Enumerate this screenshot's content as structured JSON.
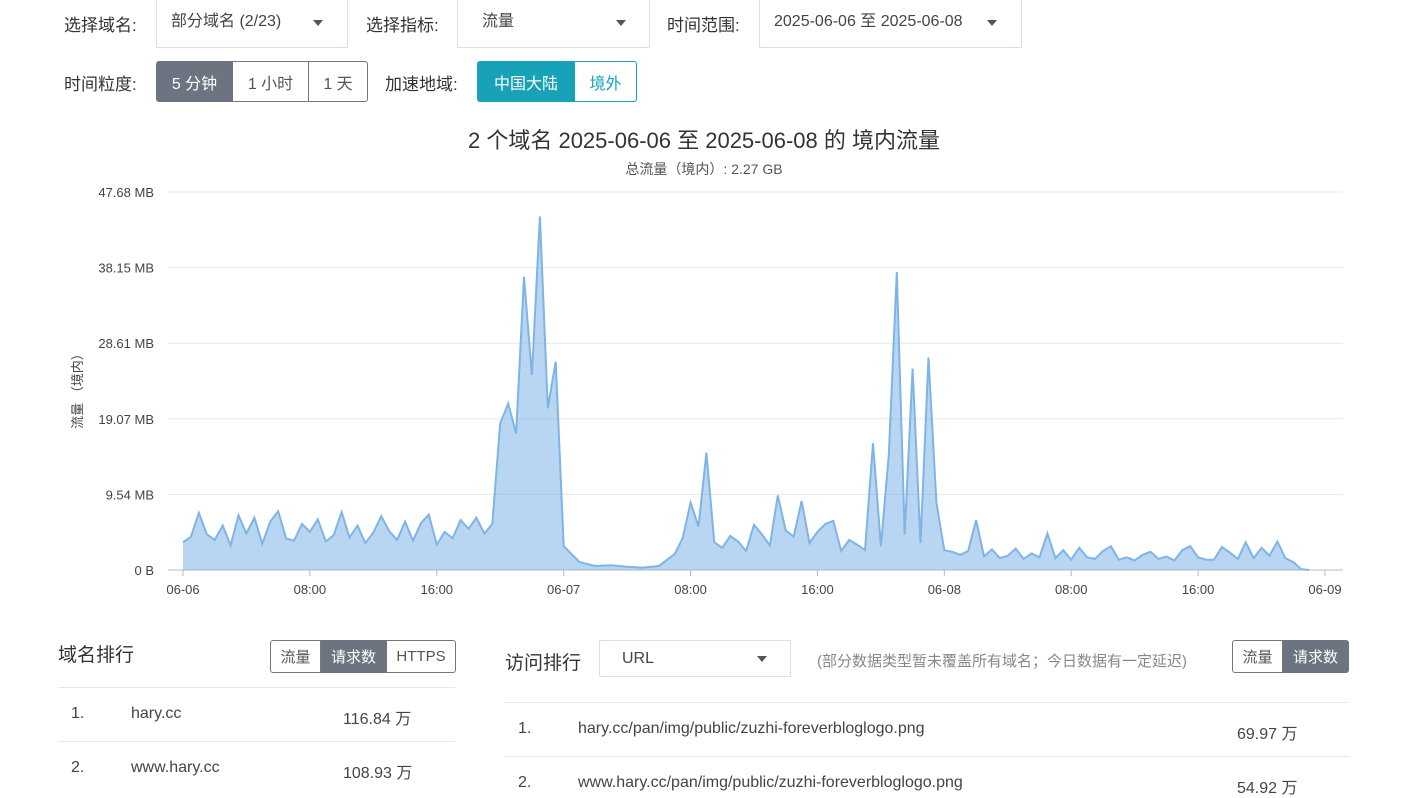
{
  "filters": {
    "domain_label": "选择域名:",
    "domain_value": "部分域名 (2/23)",
    "metric_label": "选择指标:",
    "metric_value": "流量",
    "range_label": "时间范围:",
    "range_value": "2025-06-06 至 2025-06-08",
    "granularity_label": "时间粒度:",
    "granularity_options": [
      "5 分钟",
      "1 小时",
      "1 天"
    ],
    "granularity_selected": "5 分钟",
    "region_label": "加速地域:",
    "region_options": [
      "中国大陆",
      "境外"
    ],
    "region_selected": "中国大陆"
  },
  "chart": {
    "title": "2 个域名 2025-06-06 至 2025-06-08 的 境内流量",
    "subtitle": "总流量（境内）: 2.27 GB"
  },
  "chart_data": {
    "type": "area",
    "title": "2 个域名 2025-06-06 至 2025-06-08 的 境内流量",
    "subtitle": "总流量（境内）: 2.27 GB",
    "ylabel": "流量 （境内）",
    "y_ticks": [
      "0 B",
      "9.54 MB",
      "19.07 MB",
      "28.61 MB",
      "38.15 MB",
      "47.68 MB"
    ],
    "ylim": [
      0,
      47.68
    ],
    "y_unit": "MB",
    "x_ticks": [
      "06-06",
      "08:00",
      "16:00",
      "06-07",
      "08:00",
      "16:00",
      "06-08",
      "08:00",
      "16:00",
      "06-09"
    ],
    "xlim_hours": [
      0,
      72
    ],
    "grid": true,
    "color": "#7eb4e6",
    "series": [
      {
        "x_hours": [
          0,
          0.5,
          1,
          1.5,
          2,
          2.5,
          3,
          3.5,
          4,
          4.5,
          5,
          5.5,
          6,
          6.5,
          7,
          7.5,
          8,
          8.5,
          9,
          9.5,
          10,
          10.5,
          11,
          11.5,
          12,
          12.5,
          13,
          13.5,
          14,
          14.5,
          15,
          15.5,
          16,
          16.5,
          17,
          17.5,
          18,
          18.5,
          19,
          19.5,
          20,
          20.5,
          21,
          21.5,
          22,
          22.5,
          23,
          23.5,
          24,
          25,
          26,
          27,
          28,
          29,
          30,
          31,
          31.5,
          32,
          32.5,
          33,
          33.5,
          34,
          34.5,
          35,
          35.5,
          36,
          36.5,
          37,
          37.5,
          38,
          38.5,
          39,
          39.5,
          40,
          40.5,
          41,
          41.5,
          42,
          42.5,
          43,
          43.5,
          44,
          44.5,
          45,
          45.5,
          46,
          46.5,
          47,
          47.5,
          48,
          48.5,
          49,
          49.5,
          50,
          50.5,
          51,
          51.5,
          52,
          52.5,
          53,
          53.5,
          54,
          54.5,
          55,
          55.5,
          56,
          56.5,
          57,
          57.5,
          58,
          58.5,
          59,
          59.5,
          60,
          60.5,
          61,
          61.5,
          62,
          62.5,
          63,
          63.5,
          64,
          64.5,
          65,
          65.5,
          66,
          66.5,
          67,
          67.5,
          68,
          68.5,
          69,
          69.5,
          70,
          70.5,
          71,
          72
        ],
        "values": [
          3.5,
          4.2,
          7.2,
          4.5,
          3.8,
          5.6,
          3.1,
          6.9,
          4.6,
          6.6,
          3.3,
          6.1,
          7.4,
          4.0,
          3.7,
          5.8,
          4.8,
          6.4,
          3.6,
          4.4,
          7.3,
          4.1,
          5.6,
          3.4,
          4.7,
          6.8,
          4.9,
          3.8,
          6.1,
          3.7,
          5.9,
          7.0,
          3.2,
          4.8,
          4.0,
          6.3,
          5.2,
          6.6,
          4.6,
          5.8,
          18.5,
          21.0,
          17.2,
          37.0,
          24.6,
          44.6,
          20.4,
          26.3,
          3.0,
          1.0,
          0.5,
          0.6,
          0.4,
          0.3,
          0.5,
          2.0,
          4.0,
          8.5,
          5.5,
          14.8,
          3.5,
          2.8,
          4.3,
          3.6,
          2.4,
          5.7,
          4.5,
          3.1,
          9.4,
          5.0,
          4.2,
          8.7,
          3.4,
          4.8,
          5.8,
          6.2,
          2.4,
          3.8,
          3.2,
          2.5,
          16.0,
          3.0,
          14.5,
          37.6,
          4.5,
          25.4,
          3.4,
          26.8,
          8.5,
          2.5,
          2.3,
          1.9,
          2.4,
          6.3,
          1.7,
          2.6,
          1.5,
          1.8,
          2.7,
          1.4,
          2.1,
          1.6,
          4.6,
          1.5,
          2.5,
          1.3,
          2.8,
          1.6,
          1.4,
          2.4,
          3.0,
          1.3,
          1.6,
          1.2,
          1.9,
          2.3,
          1.4,
          1.7,
          1.2,
          2.5,
          3.0,
          1.6,
          1.3,
          1.3,
          2.9,
          2.2,
          1.4,
          3.5,
          1.5,
          2.8,
          1.8,
          3.6,
          1.5,
          1.0,
          0.1,
          0
        ]
      }
    ]
  },
  "domain_rank": {
    "title": "域名排行",
    "tabs": [
      "流量",
      "请求数",
      "HTTPS"
    ],
    "active_tab": "请求数",
    "rows": [
      {
        "rank": "1.",
        "domain": "hary.cc",
        "value": "116.84 万"
      },
      {
        "rank": "2.",
        "domain": "www.hary.cc",
        "value": "108.93 万"
      }
    ]
  },
  "access_rank": {
    "title": "访问排行",
    "type_value": "URL",
    "note": "(部分数据类型暂未覆盖所有域名；今日数据有一定延迟)",
    "tabs": [
      "流量",
      "请求数"
    ],
    "active_tab": "请求数",
    "rows": [
      {
        "rank": "1.",
        "url": "hary.cc/pan/img/public/zuzhi-foreverbloglogo.png",
        "value": "69.97 万"
      },
      {
        "rank": "2.",
        "url": "www.hary.cc/pan/img/public/zuzhi-foreverbloglogo.png",
        "value": "54.92 万"
      }
    ]
  }
}
